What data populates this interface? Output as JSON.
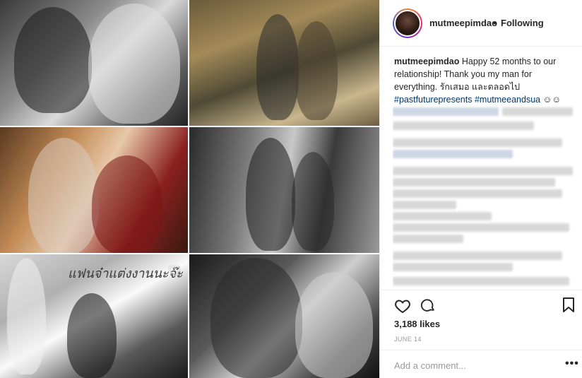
{
  "post": {
    "username": "mutmeepimdao",
    "separator": "•",
    "follow_status": "Following",
    "caption_username": "mutmeepimdao",
    "caption_text": "Happy 52 months to our relationship! Thank you my man for everything. รักเสมอ และตลอดไป",
    "hashtag_1": "#pastfuturepresents",
    "hashtag_2": "#mutmeeandsua",
    "caption_emoji": "☺☺",
    "likes": "3,188 likes",
    "date": "JUNE 14",
    "comment_placeholder": "Add a comment...",
    "more_options": "•••"
  },
  "photo_overlay": {
    "text": "แฟนจ๋าแต่งงานนะจ๊ะ",
    "heart": "♡"
  },
  "colors": {
    "hashtag": "#003569",
    "muted": "#999999",
    "text": "#262626"
  },
  "icons": [
    "heart-icon",
    "comment-icon",
    "bookmark-icon",
    "more-icon"
  ]
}
